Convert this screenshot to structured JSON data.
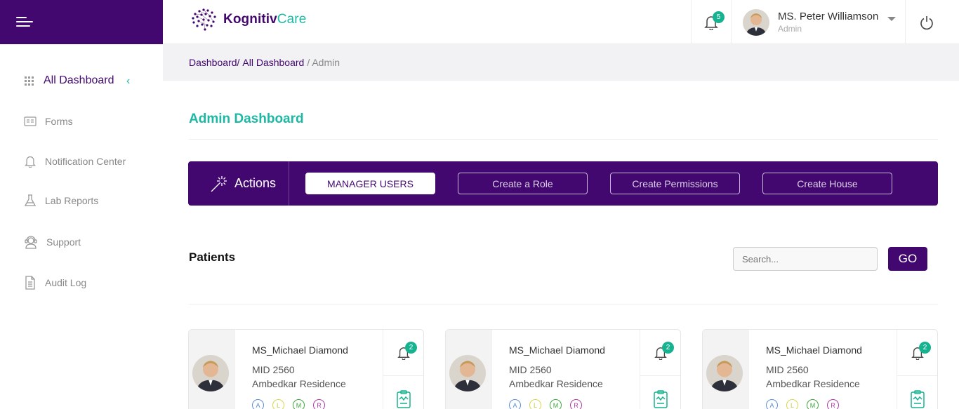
{
  "brand": {
    "name_part1": "Kognitiv",
    "name_part2": "Care"
  },
  "header": {
    "notification_count": "5",
    "user_name": "MS. Peter Williamson",
    "user_role": "Admin"
  },
  "sidebar": {
    "items": [
      {
        "label": "All Dashboard",
        "icon": "grid-icon",
        "active": true
      },
      {
        "label": "Forms",
        "icon": "form-icon"
      },
      {
        "label": "Notification Center",
        "icon": "bell-icon"
      },
      {
        "label": "Lab Reports",
        "icon": "flask-icon"
      },
      {
        "label": "Support",
        "icon": "support-icon"
      },
      {
        "label": "Audit Log",
        "icon": "document-icon"
      }
    ]
  },
  "breadcrumb": {
    "part1": "Dashboard/",
    "part2": "All Dashboard",
    "current": "/ Admin"
  },
  "page": {
    "title": "Admin Dashboard"
  },
  "actions": {
    "label": "Actions",
    "buttons": [
      "MANAGER USERS",
      "Create a Role",
      "Create Permissions",
      "Create House"
    ]
  },
  "patients": {
    "title": "Patients",
    "search_placeholder": "Search...",
    "go_label": "GO",
    "cards": [
      {
        "name": "MS_Michael Diamond",
        "mid": "MID 2560",
        "residence": "Ambedkar Residence",
        "badge": "2",
        "tags": [
          "A",
          "L",
          "M",
          "R"
        ]
      },
      {
        "name": "MS_Michael Diamond",
        "mid": "MID 2560",
        "residence": "Ambedkar Residence",
        "badge": "2",
        "tags": [
          "A",
          "L",
          "M",
          "R"
        ]
      },
      {
        "name": "MS_Michael Diamond",
        "mid": "MID 2560",
        "residence": "Ambedkar Residence",
        "badge": "2",
        "tags": [
          "A",
          "L",
          "M",
          "R"
        ]
      }
    ]
  },
  "colors": {
    "primary": "#43086f",
    "accent": "#1db8a4",
    "badge": "#17b28f"
  }
}
